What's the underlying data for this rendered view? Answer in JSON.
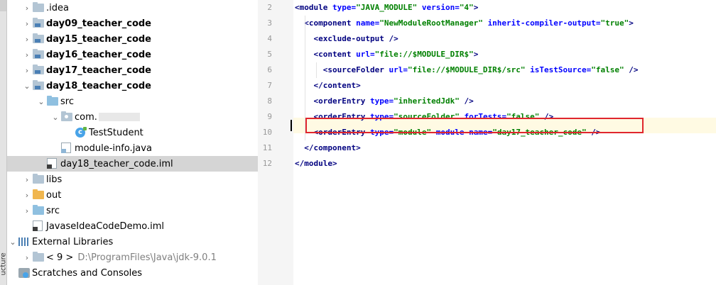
{
  "tree": {
    "items": [
      {
        "label": ".idea",
        "kind": "folder",
        "arrow": "›",
        "bold": false
      },
      {
        "label": "day09_teacher_code",
        "kind": "module",
        "arrow": "›",
        "bold": true
      },
      {
        "label": "day15_teacher_code",
        "kind": "module",
        "arrow": "›",
        "bold": true
      },
      {
        "label": "day16_teacher_code",
        "kind": "module",
        "arrow": "›",
        "bold": true
      },
      {
        "label": "day17_teacher_code",
        "kind": "module",
        "arrow": "›",
        "bold": true
      },
      {
        "label": "day18_teacher_code",
        "kind": "module",
        "arrow": "⌄",
        "bold": true
      },
      {
        "label": "src",
        "kind": "src",
        "arrow": "⌄",
        "bold": false
      },
      {
        "label": "com.",
        "kind": "package",
        "arrow": "⌄",
        "bold": false
      },
      {
        "label": "TestStudent",
        "kind": "class",
        "arrow": "",
        "bold": false
      },
      {
        "label": "module-info.java",
        "kind": "java-file",
        "arrow": "",
        "bold": false
      },
      {
        "label": "day18_teacher_code.iml",
        "kind": "iml",
        "arrow": "",
        "bold": false
      },
      {
        "label": "libs",
        "kind": "folder",
        "arrow": "›",
        "bold": false
      },
      {
        "label": "out",
        "kind": "out",
        "arrow": "›",
        "bold": false
      },
      {
        "label": "src",
        "kind": "src",
        "arrow": "›",
        "bold": false
      },
      {
        "label": "JavaseIdeaCodeDemo.iml",
        "kind": "iml",
        "arrow": "",
        "bold": false
      },
      {
        "label": "External Libraries",
        "kind": "extlib",
        "arrow": "⌄",
        "bold": false
      },
      {
        "label": "< 9 >",
        "sublabel": "D:\\ProgramFiles\\Java\\jdk-9.0.1",
        "kind": "jdk",
        "arrow": "›",
        "bold": false
      },
      {
        "label": "Scratches and Consoles",
        "kind": "scratch",
        "arrow": "",
        "bold": false
      }
    ],
    "selected_index": 10
  },
  "strip": {
    "label": "ucture"
  },
  "editor": {
    "line_numbers": [
      "2",
      "3",
      "4",
      "5",
      "6",
      "7",
      "8",
      "9",
      "10",
      "11",
      "12"
    ],
    "current_line": "10",
    "lines": [
      "<module type=\"JAVA_MODULE\" version=\"4\">",
      "  <component name=\"NewModuleRootManager\" inherit-compiler-output=\"true\">",
      "    <exclude-output />",
      "    <content url=\"file://$MODULE_DIR$\">",
      "      <sourceFolder url=\"file://$MODULE_DIR$/src\" isTestSource=\"false\" />",
      "    </content>",
      "    <orderEntry type=\"inheritedJdk\" />",
      "    <orderEntry type=\"sourceFolder\" forTests=\"false\" />",
      "    <orderEntry type=\"module\" module-name=\"day17_teacher_code\" />",
      "  </component>",
      "</module>"
    ]
  },
  "colors": {
    "tag": "#000080",
    "attr": "#0000ff",
    "value": "#008000",
    "highlight_box": "#e0262d",
    "selected_row": "#d5d5d5"
  }
}
